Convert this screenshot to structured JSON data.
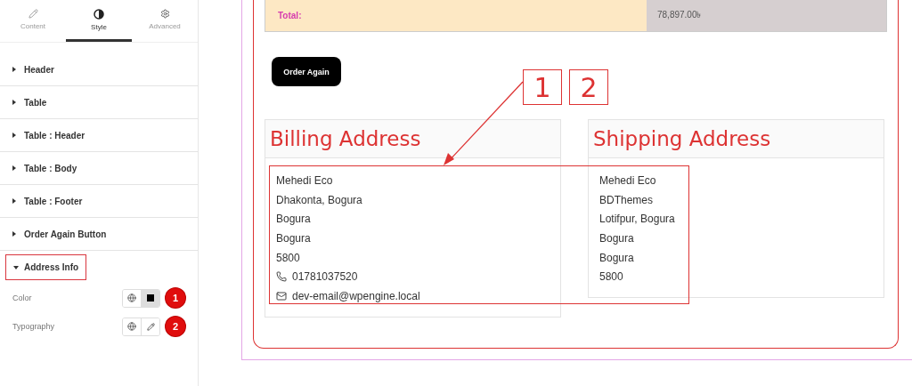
{
  "tabs": [
    {
      "label": "Content",
      "kind": "pencil",
      "selected": false
    },
    {
      "label": "Style",
      "kind": "contrast",
      "selected": true
    },
    {
      "label": "Advanced",
      "kind": "gear",
      "selected": false
    }
  ],
  "sections": [
    {
      "label": "Header",
      "expanded": false
    },
    {
      "label": "Table",
      "expanded": false
    },
    {
      "label": "Table : Header",
      "expanded": false
    },
    {
      "label": "Table : Body",
      "expanded": false
    },
    {
      "label": "Table : Footer",
      "expanded": false
    },
    {
      "label": "Order Again Button",
      "expanded": false
    },
    {
      "label": "Address Info",
      "expanded": true
    }
  ],
  "controls": [
    {
      "label": "Color",
      "kind": "color",
      "marker": "1"
    },
    {
      "label": "Typography",
      "kind": "typography",
      "marker": "2"
    }
  ],
  "total": {
    "label": "Total:",
    "value": "78,897.00৳"
  },
  "order_button": "Order Again",
  "billing": {
    "title": "Billing Address",
    "lines": [
      {
        "text": "Mehedi Eco",
        "kind": "plain"
      },
      {
        "text": "Dhakonta, Bogura",
        "kind": "plain"
      },
      {
        "text": "Bogura",
        "kind": "plain"
      },
      {
        "text": "Bogura",
        "kind": "plain"
      },
      {
        "text": "5800",
        "kind": "plain"
      },
      {
        "text": "01781037520",
        "kind": "phone"
      },
      {
        "text": "dev-email@wpengine.local",
        "kind": "email"
      }
    ]
  },
  "shipping": {
    "title": "Shipping Address",
    "lines": [
      {
        "text": "Mehedi Eco",
        "kind": "plain"
      },
      {
        "text": "BDThemes",
        "kind": "plain"
      },
      {
        "text": "Lotifpur, Bogura",
        "kind": "plain"
      },
      {
        "text": "Bogura",
        "kind": "plain"
      },
      {
        "text": "Bogura",
        "kind": "plain"
      },
      {
        "text": "5800",
        "kind": "plain"
      }
    ]
  },
  "callouts": [
    "1",
    "2"
  ]
}
